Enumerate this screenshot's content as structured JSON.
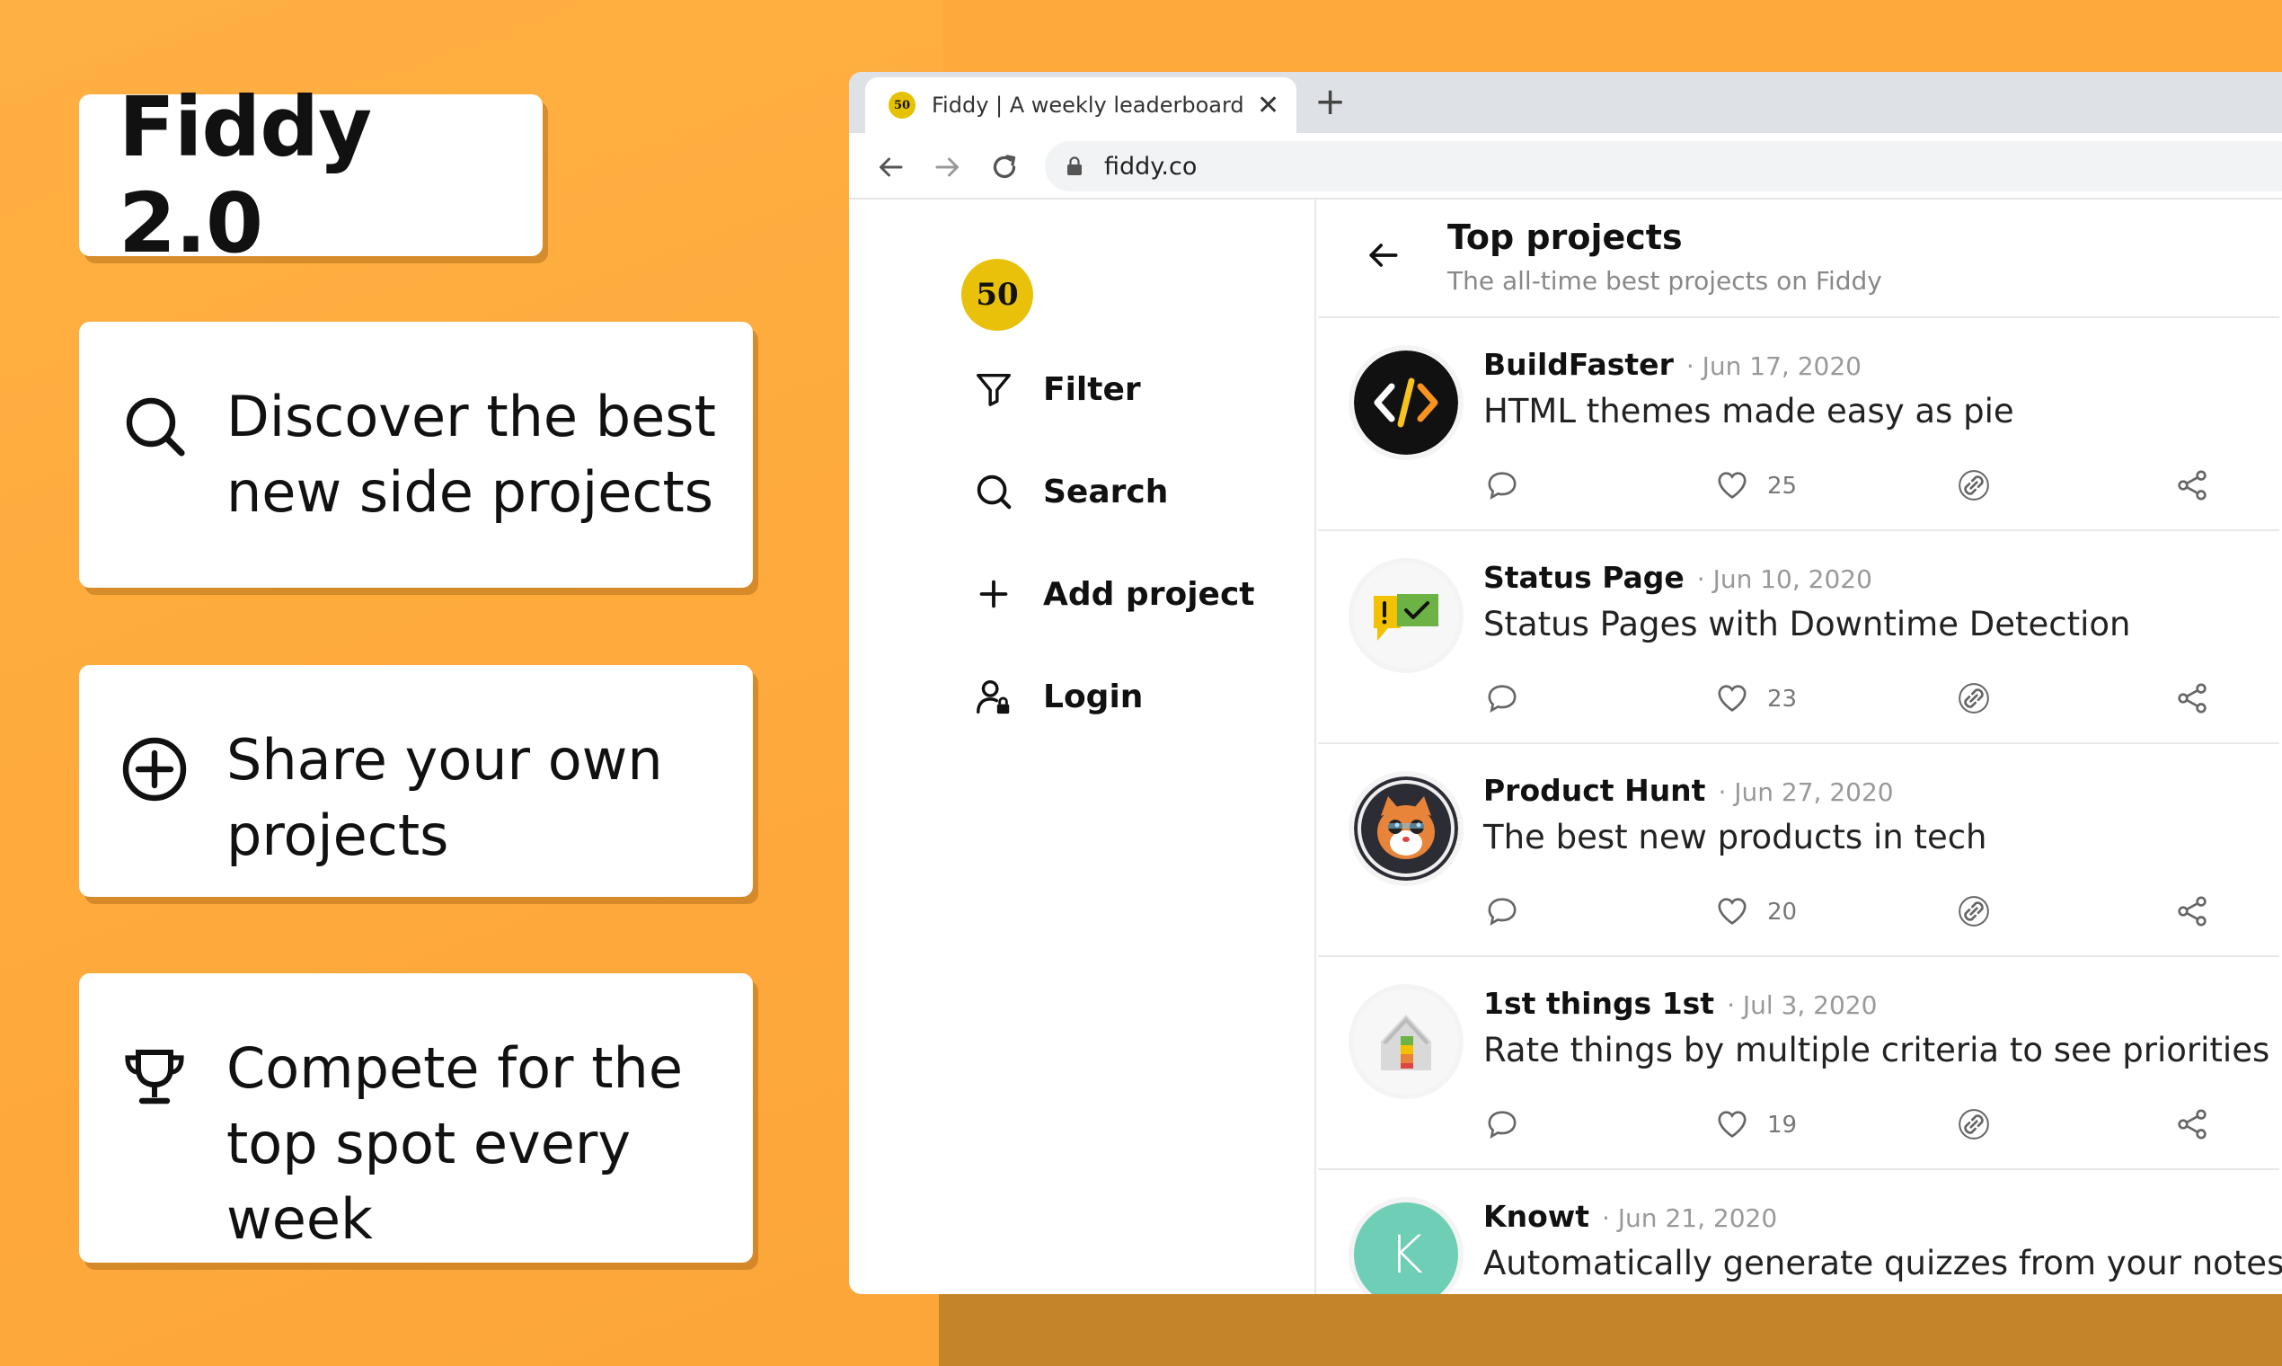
{
  "hero": {
    "title": "Fiddy 2.0",
    "features": [
      {
        "icon": "search-icon",
        "text": "Discover the best new side projects"
      },
      {
        "icon": "plus-circle-icon",
        "text": "Share your own projects"
      },
      {
        "icon": "trophy-icon",
        "text": "Compete for the top spot every week"
      }
    ]
  },
  "browser": {
    "tab_title": "Fiddy | A weekly leaderboard of t",
    "favicon_text": "50",
    "url": "fiddy.co"
  },
  "sidebar": {
    "logo_text": "50",
    "items": [
      {
        "label": "Filter",
        "icon": "filter-icon"
      },
      {
        "label": "Search",
        "icon": "search-icon"
      },
      {
        "label": "Add project",
        "icon": "plus-icon"
      },
      {
        "label": "Login",
        "icon": "user-lock-icon"
      }
    ]
  },
  "main": {
    "title": "Top projects",
    "subtitle": "The all-time best projects on Fiddy",
    "projects": [
      {
        "name": "BuildFaster",
        "date": "· Jun 17, 2020",
        "description": "HTML themes made easy as pie",
        "likes": "25"
      },
      {
        "name": "Status Page",
        "date": "· Jun 10, 2020",
        "description": "Status Pages with Downtime Detection",
        "likes": "23"
      },
      {
        "name": "Product Hunt",
        "date": "· Jun 27, 2020",
        "description": "The best new products in tech",
        "likes": "20"
      },
      {
        "name": "1st things 1st",
        "date": "· Jul 3, 2020",
        "description": "Rate things by multiple criteria to see priorities",
        "likes": "19"
      },
      {
        "name": "Knowt",
        "date": "· Jun 21, 2020",
        "description": "Automatically generate quizzes from your notes",
        "likes": ""
      }
    ],
    "knowt_avatar_letter": "K"
  },
  "colors": {
    "background": "#fea93c",
    "logo_yellow": "#e9c00a",
    "knowt_teal": "#6fcfb6"
  }
}
